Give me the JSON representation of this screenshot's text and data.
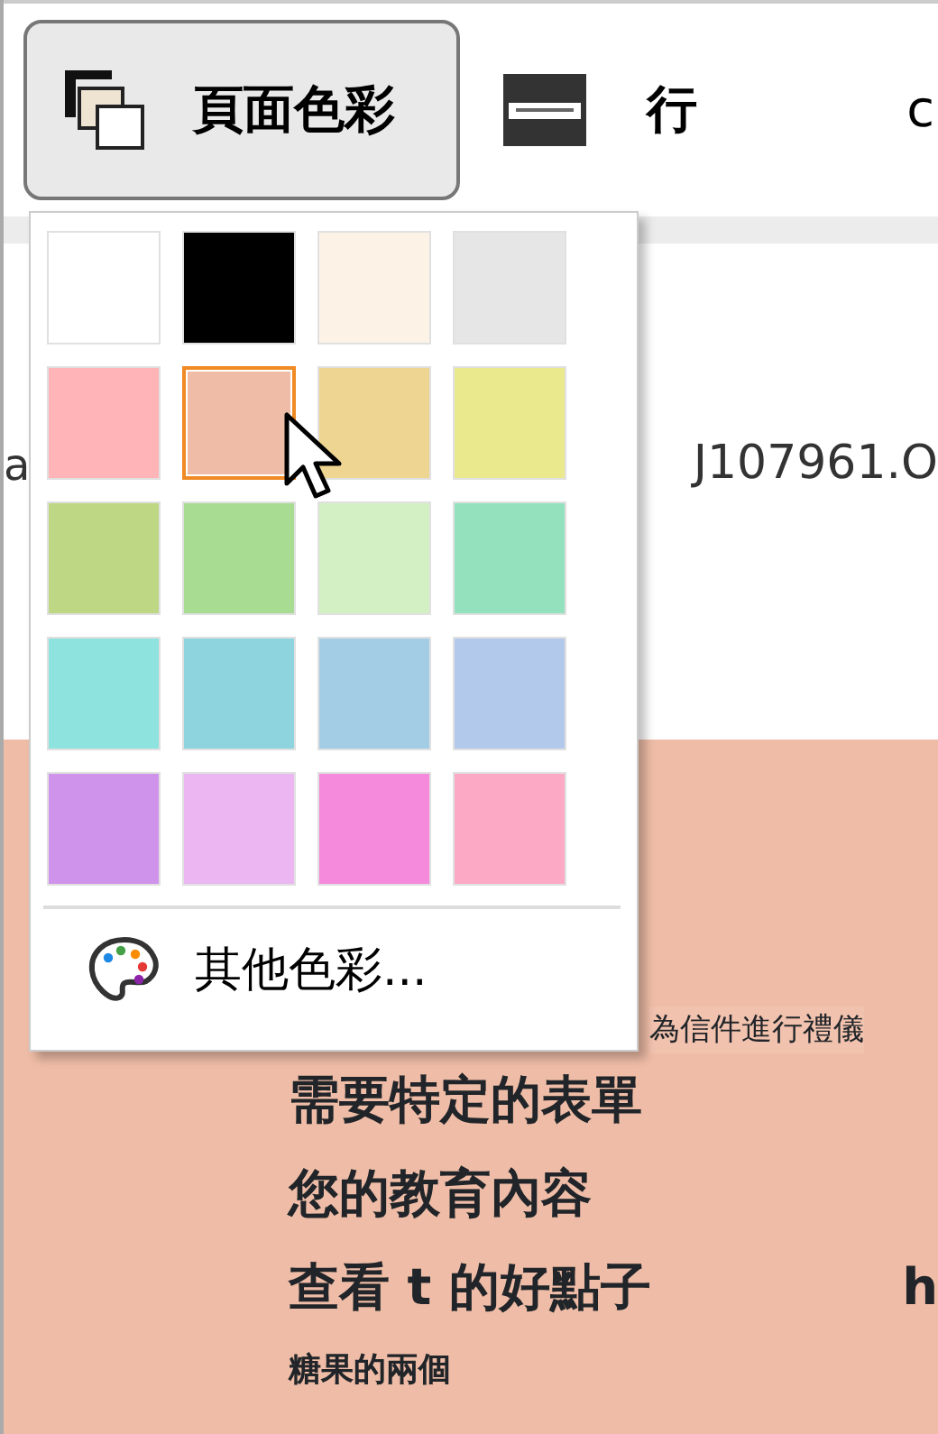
{
  "toolbar": [
    {
      "label": "頁面色彩",
      "kind": "page-color",
      "pressed": true
    },
    {
      "label": "行",
      "kind": "line",
      "pressed": false
    },
    {
      "label": "c",
      "kind": "text",
      "pressed": false
    }
  ],
  "background_text": [
    {
      "text": "a",
      "kind": "left"
    },
    {
      "text": "J107961.O",
      "kind": "right"
    }
  ],
  "color_menu": {
    "swatches": [
      {
        "color": "#ffffff",
        "selected": false
      },
      {
        "color": "#000000",
        "selected": false
      },
      {
        "color": "#fcf3e6",
        "selected": false
      },
      {
        "color": "#e6e6e6",
        "selected": false
      },
      {
        "color": "#ffb5b8",
        "selected": false
      },
      {
        "color": "#efbda7",
        "selected": true
      },
      {
        "color": "#eed591",
        "selected": false
      },
      {
        "color": "#ebe98d",
        "selected": false
      },
      {
        "color": "#bdd785",
        "selected": false
      },
      {
        "color": "#a8dc93",
        "selected": false
      },
      {
        "color": "#d3f0c4",
        "selected": false
      },
      {
        "color": "#94e1be",
        "selected": false
      },
      {
        "color": "#8ee3de",
        "selected": false
      },
      {
        "color": "#8ed4df",
        "selected": false
      },
      {
        "color": "#a3cde4",
        "selected": false
      },
      {
        "color": "#b3c9ec",
        "selected": false
      },
      {
        "color": "#d093ec",
        "selected": false
      },
      {
        "color": "#ebb6f2",
        "selected": false
      },
      {
        "color": "#f589db",
        "selected": false
      },
      {
        "color": "#fba9c5",
        "selected": false
      }
    ],
    "more_colors": "其他色彩..."
  },
  "document": {
    "lines": [
      {
        "parts": [
          {
            "text": "為信件進行禮儀",
            "kind": "small"
          }
        ]
      },
      {
        "parts": [
          {
            "text": "需要特定的表單",
            "kind": "bold"
          }
        ]
      },
      {
        "parts": [
          {
            "text": "您的教育內容",
            "kind": "bold"
          }
        ]
      },
      {
        "parts": [
          {
            "text": "查看 t 的好點子",
            "kind": "bold"
          },
          {
            "text": "h",
            "kind": "edge"
          }
        ]
      },
      {
        "parts": [
          {
            "text": "糖果的兩個",
            "kind": "smallbold"
          }
        ]
      }
    ]
  }
}
